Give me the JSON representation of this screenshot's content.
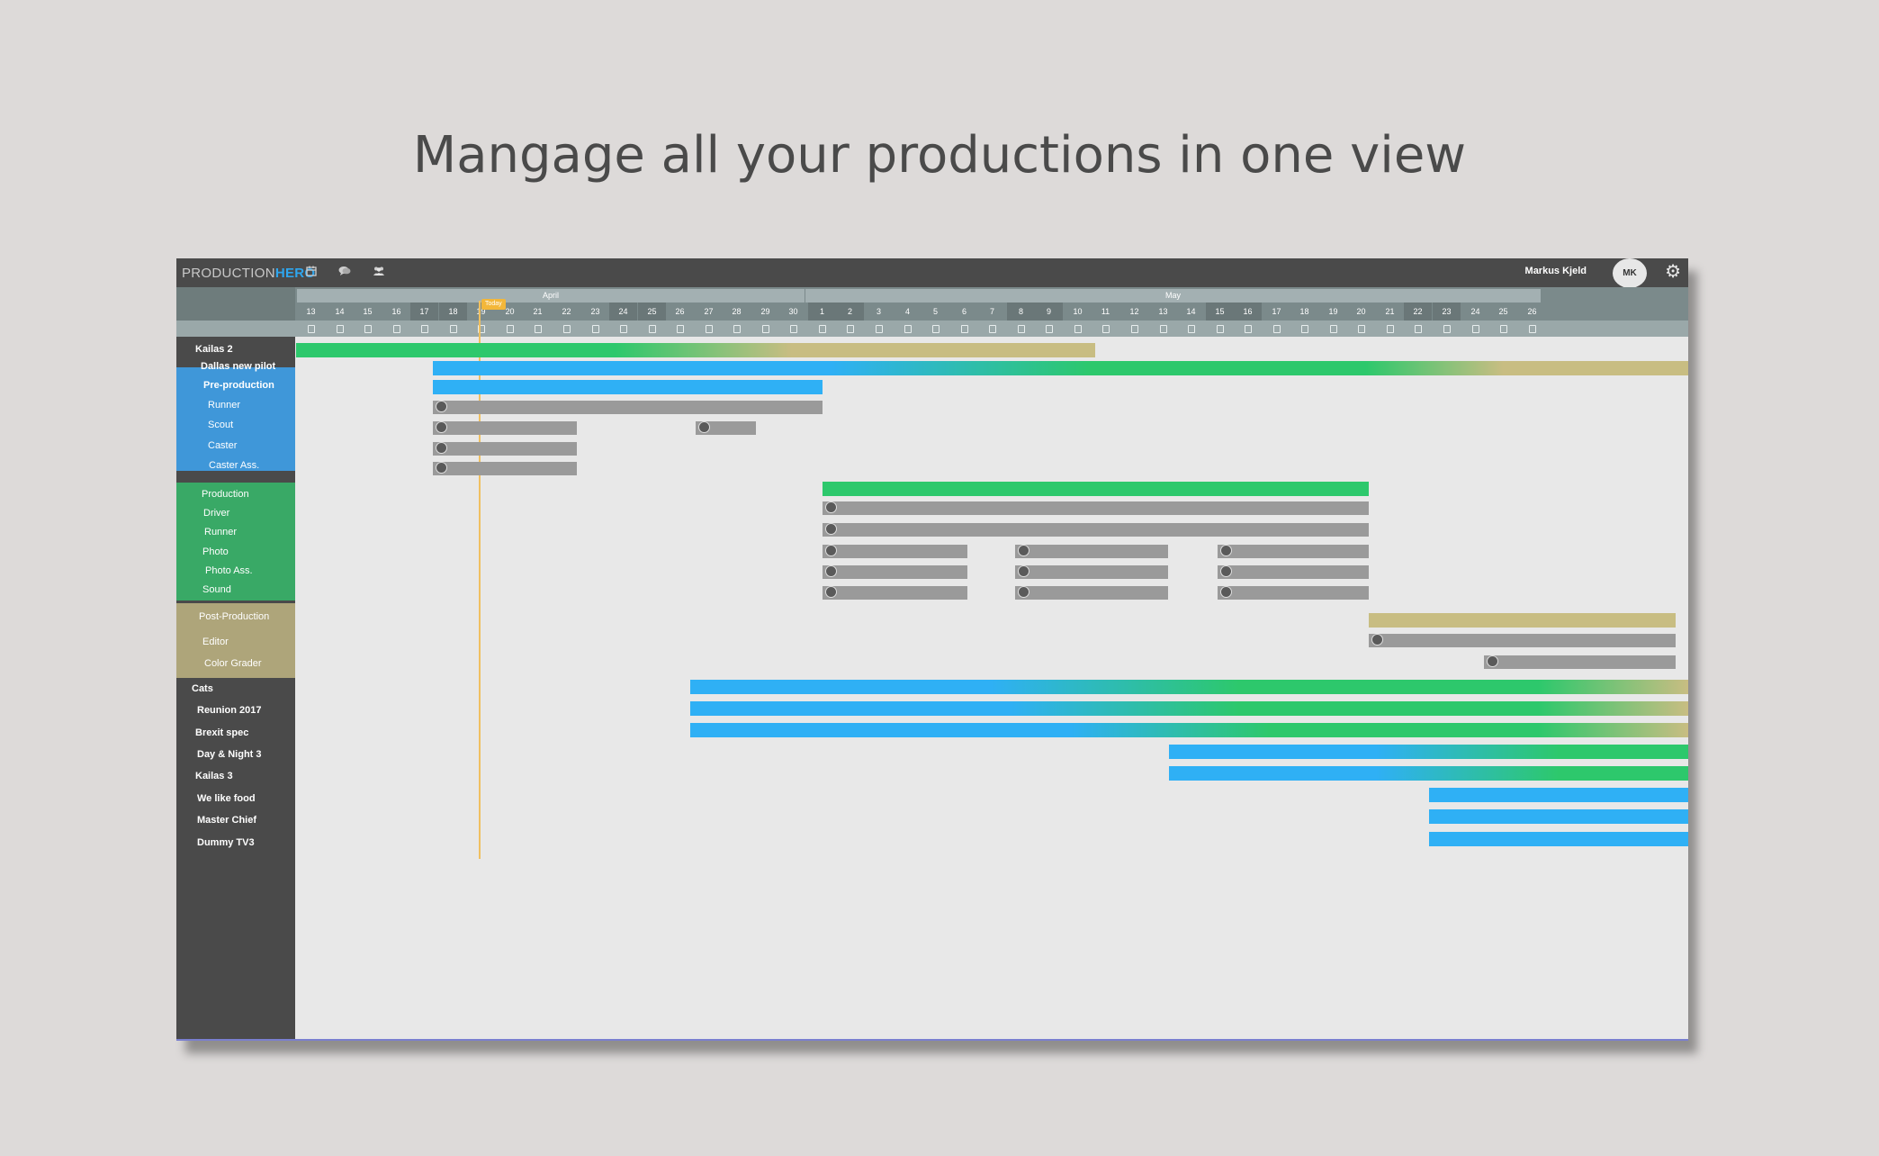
{
  "headline": "Mangage all your productions in one view",
  "app": {
    "logo_light": "PRODUCTION",
    "logo_bold": "HERO",
    "user_name": "Markus Kjeld",
    "user_initials": "MK",
    "icons": [
      "calendar-icon",
      "chat-icon",
      "people-icon",
      "gear-icon"
    ]
  },
  "calendar": {
    "months": [
      "April",
      "May"
    ],
    "days": [
      "13",
      "14",
      "15",
      "16",
      "17",
      "18",
      "19",
      "20",
      "21",
      "22",
      "23",
      "24",
      "25",
      "26",
      "27",
      "28",
      "29",
      "30",
      "1",
      "2",
      "3",
      "4",
      "5",
      "6",
      "7",
      "8",
      "9",
      "10",
      "11",
      "12",
      "13",
      "14",
      "15",
      "16",
      "17",
      "18",
      "19",
      "20",
      "21",
      "22",
      "23",
      "24",
      "25",
      "26"
    ],
    "today_label": "Today"
  },
  "sidebar": {
    "items": [
      {
        "label": "Kailas 2"
      },
      {
        "label": "Dallas new pilot"
      },
      {
        "label": "Pre-production"
      },
      {
        "label": "Runner"
      },
      {
        "label": "Scout"
      },
      {
        "label": "Caster"
      },
      {
        "label": "Caster Ass."
      },
      {
        "label": "Production"
      },
      {
        "label": "Driver"
      },
      {
        "label": "Runner"
      },
      {
        "label": "Photo"
      },
      {
        "label": "Photo Ass."
      },
      {
        "label": "Sound"
      },
      {
        "label": "Post-Production"
      },
      {
        "label": "Editor"
      },
      {
        "label": "Color Grader"
      },
      {
        "label": "Cats"
      },
      {
        "label": "Reunion 2017"
      },
      {
        "label": "Brexit spec"
      },
      {
        "label": "Day & Night 3"
      },
      {
        "label": "Kailas 3"
      },
      {
        "label": "We like food"
      },
      {
        "label": "Master Chief"
      },
      {
        "label": "Dummy TV3"
      }
    ]
  },
  "colors": {
    "blue": "#2fb0f5",
    "green": "#2dc86c",
    "khaki": "#c8bd82",
    "pre_production": "#3f97d9",
    "production": "#39a966",
    "post_production": "#aea57a",
    "person_bar": "#9a9a9a",
    "today": "#f3b73a"
  }
}
